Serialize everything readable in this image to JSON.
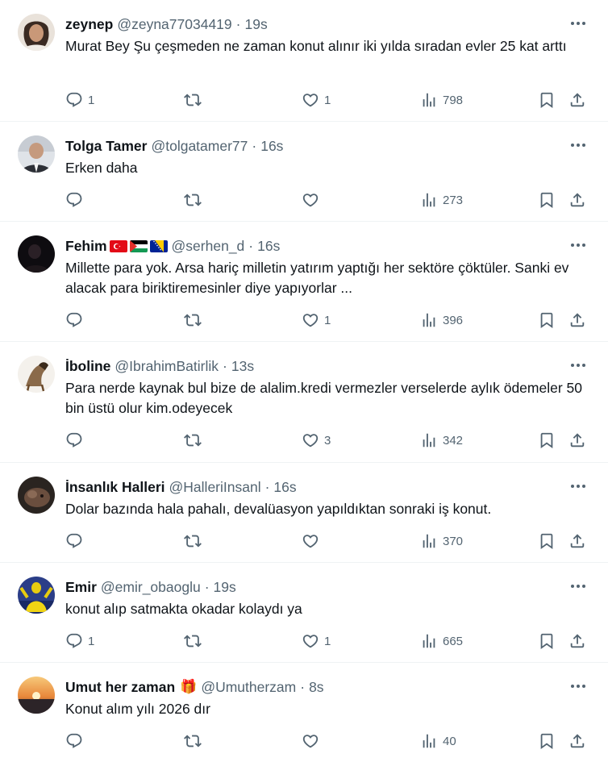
{
  "tweets": [
    {
      "name": "zeynep",
      "handle": "@zeyna77034419",
      "time": "19s",
      "text": "Murat Bey Şu çeşmeden ne zaman konut alınır iki yılda sıradan evler 25 kat arttı",
      "replies": "1",
      "retweets": "",
      "likes": "1",
      "views": "798"
    },
    {
      "name": "Tolga Tamer",
      "handle": "@tolgatamer77",
      "time": "16s",
      "text": "Erken daha",
      "replies": "",
      "retweets": "",
      "likes": "",
      "views": "273"
    },
    {
      "name": "Fehim",
      "handle": "@serhen_d",
      "time": "16s",
      "text": "Millette para yok. Arsa hariç milletin yatırım yaptığı her sektöre çöktüler. Sanki ev alacak para biriktiremesinler diye yapıyorlar ...",
      "replies": "",
      "retweets": "",
      "likes": "1",
      "views": "396"
    },
    {
      "name": "İboline",
      "handle": "@IbrahimBatirlik",
      "time": "13s",
      "text": "Para nerde kaynak bul bize de alalim.kredi vermezler verselerde aylık ödemeler 50 bin üstü olur kim.odeyecek",
      "replies": "",
      "retweets": "",
      "likes": "3",
      "views": "342"
    },
    {
      "name": "İnsanlık Halleri",
      "handle": "@HalleriInsanl",
      "time": "16s",
      "text": "Dolar bazında hala pahalı, devalüasyon yapıldıktan sonraki iş konut.",
      "replies": "",
      "retweets": "",
      "likes": "",
      "views": "370"
    },
    {
      "name": "Emir",
      "handle": "@emir_obaoglu",
      "time": "19s",
      "text": "konut alıp satmakta okadar kolaydı ya",
      "replies": "1",
      "retweets": "",
      "likes": "1",
      "views": "665"
    },
    {
      "name": "Umut her zaman",
      "handle": "@Umutherzam",
      "time": "8s",
      "text": "Konut alım yılı 2026 dır",
      "replies": "",
      "retweets": "",
      "likes": "",
      "views": "40"
    }
  ],
  "separator": "·",
  "icons": {
    "more": "more-dots-icon",
    "reply": "reply-icon",
    "retweet": "retweet-icon",
    "like": "heart-icon",
    "views": "views-chart-icon",
    "bookmark": "bookmark-icon",
    "share": "share-icon"
  },
  "colors": {
    "text": "#0f1419",
    "secondary": "#536471",
    "divider": "#eff3f4"
  }
}
